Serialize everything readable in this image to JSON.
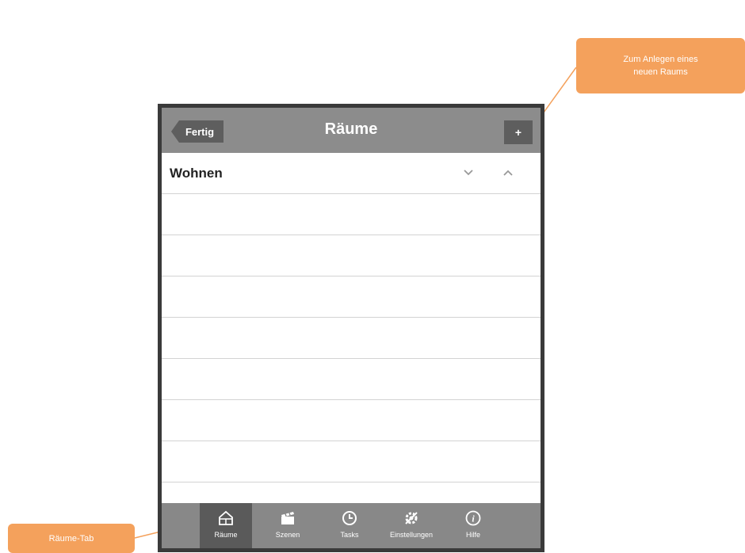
{
  "nav": {
    "back_label": "Fertig",
    "title": "Räume",
    "add_label": "+"
  },
  "rooms": [
    {
      "label": "Wohnen"
    }
  ],
  "tabs": [
    {
      "label": "Räume",
      "icon": "house-icon",
      "active": true
    },
    {
      "label": "Szenen",
      "icon": "clapperboard-icon",
      "active": false
    },
    {
      "label": "Tasks",
      "icon": "clock-icon",
      "active": false
    },
    {
      "label": "Einstellungen",
      "icon": "settings-icon",
      "active": false
    },
    {
      "label": "Hilfe",
      "icon": "info-icon",
      "active": false
    }
  ],
  "annotations": {
    "add_callout_line1": "Zum Anlegen eines",
    "add_callout_line2": "neuen Raums",
    "tab_callout": "Räume-Tab"
  },
  "colors": {
    "nav_bar": "#8c8c8c",
    "tab_bar": "#888888",
    "active_tab": "#5a5a5a",
    "callout": "#f4a15c"
  }
}
